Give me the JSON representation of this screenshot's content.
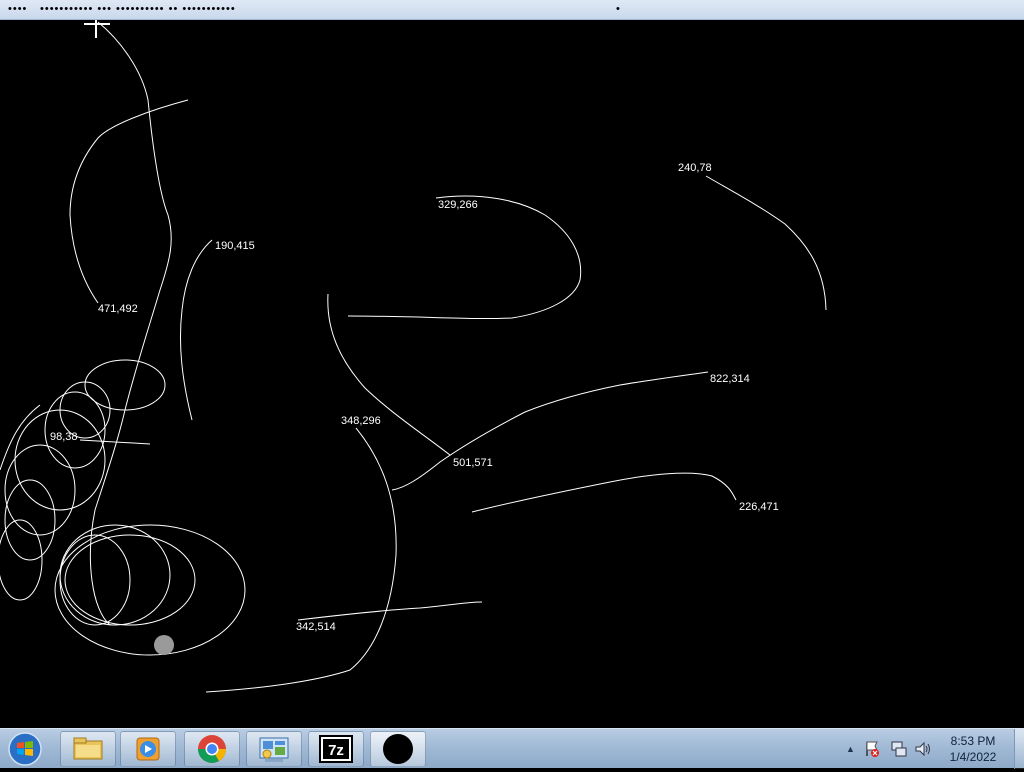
{
  "window": {
    "title_segments": [
      "••••",
      "••••••••••• ••• •••••••••• •• •••••••••••",
      "•"
    ]
  },
  "canvas": {
    "labels": [
      {
        "id": "471-492",
        "text": "471,492"
      },
      {
        "id": "190-415",
        "text": "190,415"
      },
      {
        "id": "329-266",
        "text": "329,266"
      },
      {
        "id": "240-78",
        "text": "240,78"
      },
      {
        "id": "822-314",
        "text": "822,314"
      },
      {
        "id": "348-296",
        "text": "348,296"
      },
      {
        "id": "501-571",
        "text": "501,571"
      },
      {
        "id": "226-471",
        "text": "226,471"
      },
      {
        "id": "342-514",
        "text": "342,514"
      },
      {
        "id": "98-38",
        "text": "98,38"
      }
    ]
  },
  "taskbar": {
    "items": [
      {
        "name": "windows-explorer",
        "icon": "folder-icon"
      },
      {
        "name": "media-player",
        "icon": "media-player-icon"
      },
      {
        "name": "chrome",
        "icon": "chrome-icon"
      },
      {
        "name": "control-panel",
        "icon": "control-panel-icon"
      },
      {
        "name": "7zip",
        "icon": "7zip-icon",
        "label": "7z"
      },
      {
        "name": "black-circle-app",
        "icon": "black-circle-icon"
      }
    ],
    "clock": {
      "time": "8:53 PM",
      "date": "1/4/2022"
    },
    "tray_icons": [
      "show-hidden-icons-arrow",
      "action-center-flag-icon",
      "network-icon",
      "volume-icon"
    ]
  },
  "colors": {
    "canvas_bg": "#000000",
    "stroke": "#ffffff",
    "taskbar": "#a9c0da"
  }
}
